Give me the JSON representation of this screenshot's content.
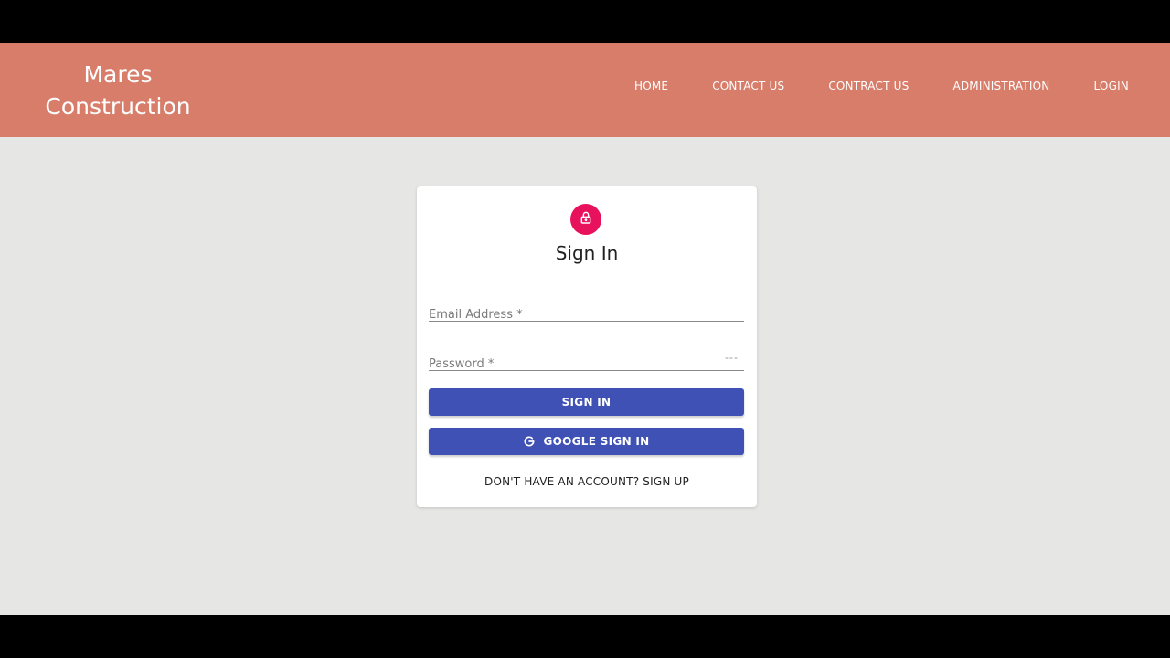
{
  "brand": {
    "line1": "Mares",
    "line2": "Construction"
  },
  "nav": {
    "items": [
      {
        "label": "HOME"
      },
      {
        "label": "CONTACT US"
      },
      {
        "label": "CONTRACT US"
      },
      {
        "label": "ADMINISTRATION"
      },
      {
        "label": "LOGIN"
      }
    ]
  },
  "signin": {
    "title": "Sign In",
    "email_placeholder": "Email Address *",
    "password_placeholder": "Password *",
    "password_toggle": "---",
    "submit_label": "SIGN IN",
    "google_label": "GOOGLE SIGN IN",
    "signup_label": "DON'T HAVE AN ACCOUNT? SIGN UP"
  },
  "colors": {
    "navbar": "#d77d6a",
    "background": "#e6e7e5",
    "primary_button": "#3f51b5",
    "lock_avatar": "#e8115c"
  },
  "icons": {
    "avatar": "lock-icon",
    "google": "google-icon"
  }
}
